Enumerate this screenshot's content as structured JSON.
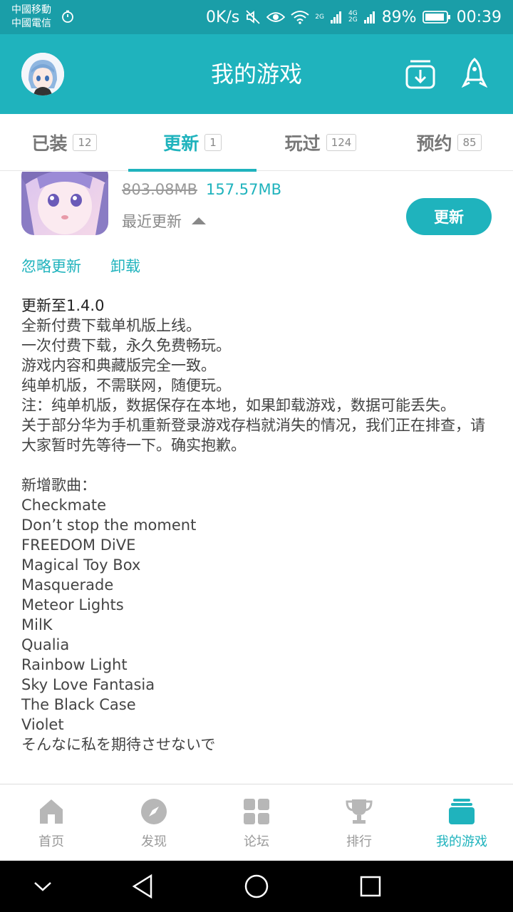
{
  "status_bar": {
    "carrier_1": "中國移動",
    "carrier_2": "中國電信",
    "net_speed": "0K/s",
    "sig1_label_top": "2G",
    "sig2_label_top": "4G",
    "sig2_label_bottom": "2G",
    "battery": "89%",
    "time": "00:39"
  },
  "app_bar": {
    "title": "我的游戏"
  },
  "tabs": [
    {
      "label": "已装",
      "count": "12"
    },
    {
      "label": "更新",
      "count": "1"
    },
    {
      "label": "玩过",
      "count": "124"
    },
    {
      "label": "预约",
      "count": "85"
    }
  ],
  "game": {
    "size_old": "803.08MB",
    "size_new": "157.57MB",
    "recent_label": "最近更新",
    "update_button": "更新",
    "ignore_link": "忽略更新",
    "uninstall_link": "卸载"
  },
  "notes": {
    "version": "更新至1.4.0",
    "lines": [
      "全新付费下载单机版上线。",
      "一次付费下载，永久免费畅玩。",
      "游戏内容和典藏版完全一致。",
      "纯单机版，不需联网，随便玩。",
      "注：纯单机版，数据保存在本地，如果卸载游戏，数据可能丢失。",
      "关于部分华为手机重新登录游戏存档就消失的情况，我们正在排查，请大家暂时先等待一下。确实抱歉。"
    ],
    "songs_header": "新增歌曲：",
    "songs": [
      "Checkmate",
      "Don’t stop the moment",
      "FREEDOM DiVE",
      "Magical Toy Box",
      "Masquerade",
      "Meteor Lights",
      "MilK",
      "Qualia",
      "Rainbow Light",
      "Sky Love Fantasia",
      "The Black Case",
      "Violet",
      "そんなに私を期待させないで"
    ]
  },
  "bottom_nav": [
    {
      "label": "首页",
      "icon": "home-icon"
    },
    {
      "label": "发现",
      "icon": "compass-icon"
    },
    {
      "label": "论坛",
      "icon": "grid-icon"
    },
    {
      "label": "排行",
      "icon": "trophy-icon"
    },
    {
      "label": "我的游戏",
      "icon": "stack-icon"
    }
  ],
  "colors": {
    "accent": "#1fb3bd",
    "status_bar": "#1a9ea8"
  }
}
